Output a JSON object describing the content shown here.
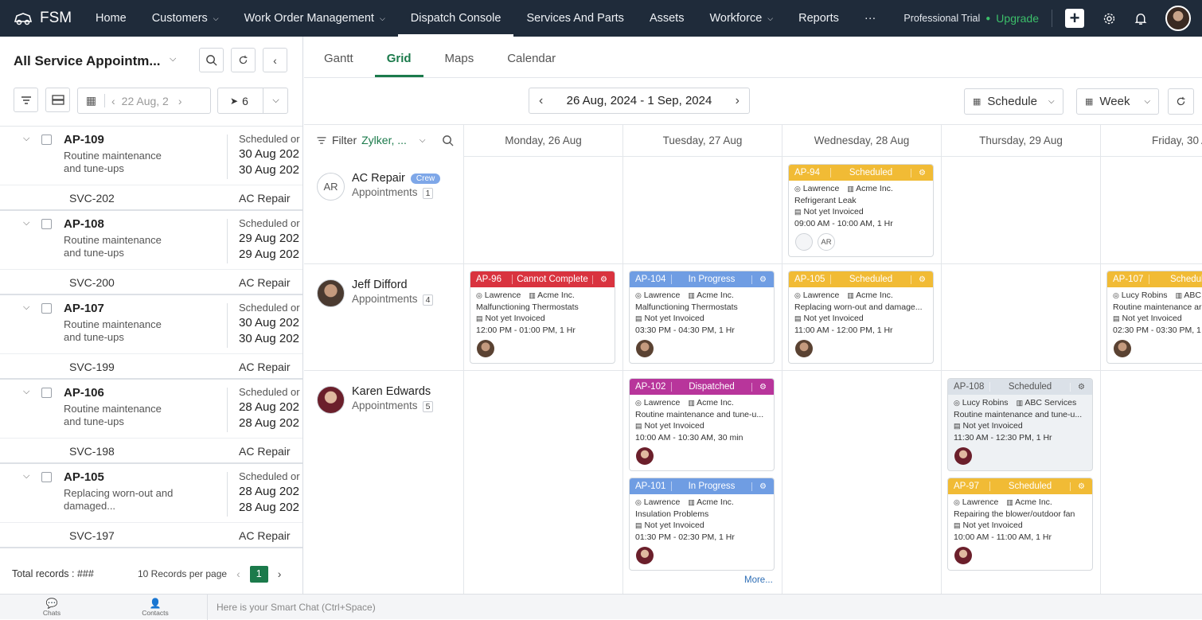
{
  "app": {
    "name": "FSM"
  },
  "nav": [
    {
      "label": "Home",
      "dropdown": false
    },
    {
      "label": "Customers",
      "dropdown": true
    },
    {
      "label": "Work Order Management",
      "dropdown": true
    },
    {
      "label": "Dispatch Console",
      "dropdown": false,
      "active": true
    },
    {
      "label": "Services And Parts",
      "dropdown": false
    },
    {
      "label": "Assets",
      "dropdown": false
    },
    {
      "label": "Workforce",
      "dropdown": true
    },
    {
      "label": "Reports",
      "dropdown": false
    },
    {
      "label": "···",
      "dropdown": false
    }
  ],
  "topright": {
    "trial": "Professional Trial",
    "upgrade": "Upgrade"
  },
  "left": {
    "title": "All Service Appointm...",
    "date": "22 Aug, 2",
    "dispatch_count": "6",
    "records": [
      {
        "id": "AP-109",
        "desc": "Routine maintenance and tune-ups",
        "status": "Scheduled or",
        "d1": "30 Aug 202",
        "d2": "30 Aug 202",
        "svc": "SVC-202",
        "cat": "AC Repair"
      },
      {
        "id": "AP-108",
        "desc": "Routine maintenance and tune-ups",
        "status": "Scheduled or",
        "d1": "29 Aug 202",
        "d2": "29 Aug 202",
        "svc": "SVC-200",
        "cat": "AC Repair"
      },
      {
        "id": "AP-107",
        "desc": "Routine maintenance and tune-ups",
        "status": "Scheduled or",
        "d1": "30 Aug 202",
        "d2": "30 Aug 202",
        "svc": "SVC-199",
        "cat": "AC Repair"
      },
      {
        "id": "AP-106",
        "desc": "Routine maintenance and tune-ups",
        "status": "Scheduled or",
        "d1": "28 Aug 202",
        "d2": "28 Aug 202",
        "svc": "SVC-198",
        "cat": "AC Repair"
      },
      {
        "id": "AP-105",
        "desc": "Replacing worn-out and damaged...",
        "status": "Scheduled or",
        "d1": "28 Aug 202",
        "d2": "28 Aug 202",
        "svc": "SVC-197",
        "cat": "AC Repair"
      }
    ],
    "total": "Total records : ###",
    "per_page": "10 Records per page",
    "page": "1"
  },
  "main": {
    "tabs": [
      "Gantt",
      "Grid",
      "Maps",
      "Calendar"
    ],
    "active_tab": "Grid",
    "range_start": "26 Aug, 2024",
    "range_sep": "-",
    "range_end": "1 Sep, 2024",
    "schedule": "Schedule",
    "week": "Week",
    "filter_label": "Filter",
    "filter_value": "Zylker, ...",
    "days": [
      "Monday, 26 Aug",
      "Tuesday, 27 Aug",
      "Wednesday, 28 Aug",
      "Thursday, 29 Aug",
      "Friday, 30 A"
    ],
    "resources": [
      {
        "initials": "AR",
        "name": "AC Repair",
        "badge": "Crew",
        "label": "Appointments",
        "count": "1"
      },
      {
        "name": "Jeff Difford",
        "label": "Appointments",
        "count": "4"
      },
      {
        "name": "Karen Edwards",
        "label": "Appointments",
        "count": "5"
      }
    ],
    "cards": [
      {
        "id": "AP-94",
        "status": "Scheduled",
        "color": "yellow",
        "tech": "Lawrence",
        "customer": "Acme Inc.",
        "desc": "Refrigerant Leak",
        "invoice": "Not yet Invoiced",
        "time": "09:00 AM - 10:00 AM, 1 Hr",
        "crew_initials": "AR"
      },
      {
        "id": "AP-96",
        "status": "Cannot Complete",
        "color": "red",
        "tech": "Lawrence",
        "customer": "Acme Inc.",
        "desc": "Malfunctioning Thermostats",
        "invoice": "Not yet Invoiced",
        "time": "12:00 PM - 01:00 PM, 1 Hr"
      },
      {
        "id": "AP-104",
        "status": "In Progress",
        "color": "blue",
        "tech": "Lawrence",
        "customer": "Acme Inc.",
        "desc": "Malfunctioning Thermostats",
        "invoice": "Not yet Invoiced",
        "time": "03:30 PM - 04:30 PM, 1 Hr"
      },
      {
        "id": "AP-105",
        "status": "Scheduled",
        "color": "yellow",
        "tech": "Lawrence",
        "customer": "Acme Inc.",
        "desc": "Replacing worn-out and damage...",
        "invoice": "Not yet Invoiced",
        "time": "11:00 AM - 12:00 PM, 1 Hr"
      },
      {
        "id": "AP-107",
        "status": "Schedule",
        "color": "yellow",
        "tech": "Lucy Robins",
        "customer": "ABC",
        "desc": "Routine maintenance ar",
        "invoice": "Not yet Invoiced",
        "time": "02:30 PM - 03:30 PM, 1"
      },
      {
        "id": "AP-102",
        "status": "Dispatched",
        "color": "purple",
        "tech": "Lawrence",
        "customer": "Acme Inc.",
        "desc": "Routine maintenance and tune-u...",
        "invoice": "Not yet Invoiced",
        "time": "10:00 AM - 10:30 AM, 30 min"
      },
      {
        "id": "AP-108",
        "status": "Scheduled",
        "color": "gray",
        "tech": "Lucy Robins",
        "customer": "ABC Services",
        "desc": "Routine maintenance and tune-u...",
        "invoice": "Not yet Invoiced",
        "time": "11:30 AM - 12:30 PM, 1 Hr"
      },
      {
        "id": "AP-101",
        "status": "In Progress",
        "color": "blue",
        "tech": "Lawrence",
        "customer": "Acme Inc.",
        "desc": "Insulation Problems",
        "invoice": "Not yet Invoiced",
        "time": "01:30 PM - 02:30 PM, 1 Hr"
      },
      {
        "id": "AP-97",
        "status": "Scheduled",
        "color": "yellow",
        "tech": "Lawrence",
        "customer": "Acme Inc.",
        "desc": "Repairing the blower/outdoor fan",
        "invoice": "Not yet Invoiced",
        "time": "10:00 AM - 11:00 AM, 1 Hr"
      }
    ],
    "more": "More..."
  },
  "bottom": {
    "chats": "Chats",
    "contacts": "Contacts",
    "smart_chat": "Here is your Smart Chat (Ctrl+Space)"
  }
}
